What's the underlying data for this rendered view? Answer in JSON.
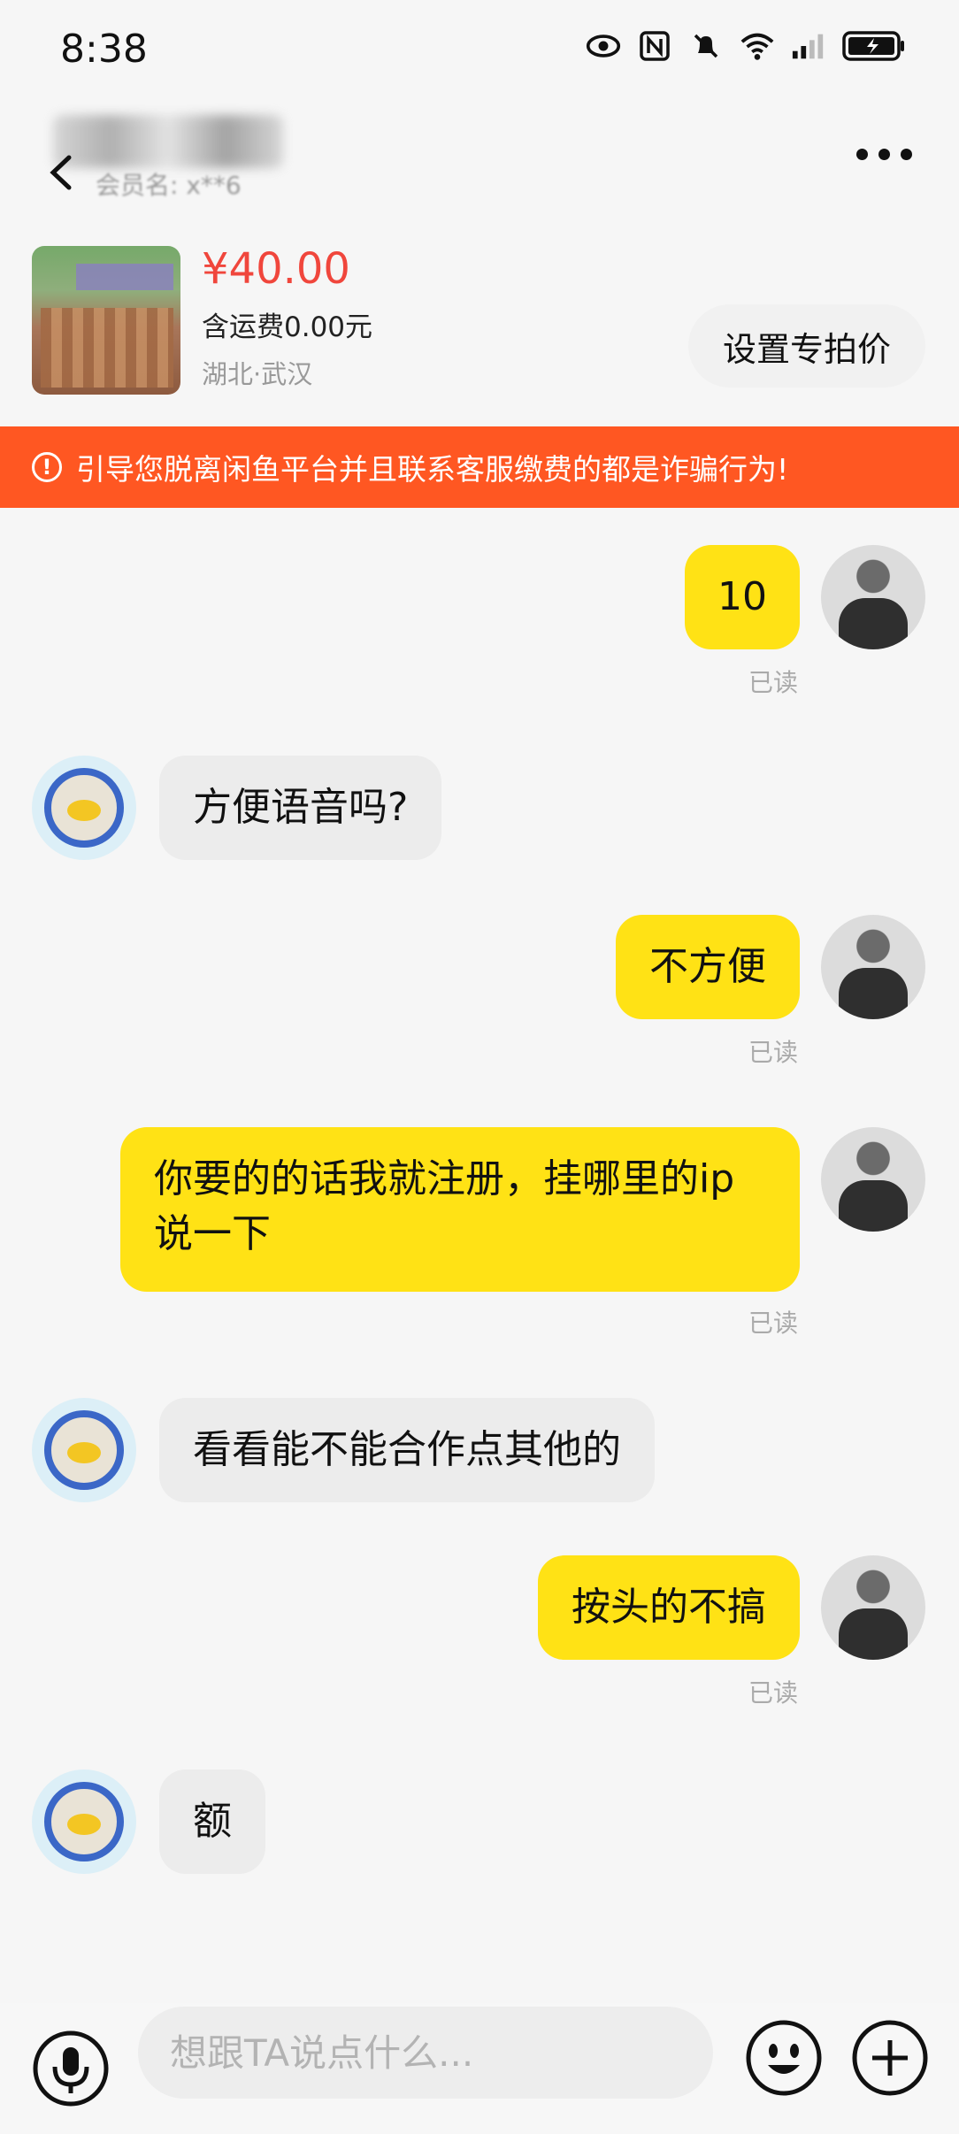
{
  "status": {
    "time": "8:38"
  },
  "header": {
    "seller_sub": "会员名: x**6"
  },
  "item": {
    "price": "¥40.00",
    "shipping": "含运费0.00元",
    "location": "湖北·武汉",
    "special_price_label": "设置专拍价"
  },
  "warning": {
    "text": "引导您脱离闲鱼平台并且联系客服缴费的都是诈骗行为!"
  },
  "messages": [
    {
      "from": "me",
      "text": "10",
      "status": "已读"
    },
    {
      "from": "them",
      "text": "方便语音吗?"
    },
    {
      "from": "me",
      "text": "不方便",
      "status": "已读"
    },
    {
      "from": "me",
      "text": "你要的的话我就注册，挂哪里的ip说一下",
      "status": "已读"
    },
    {
      "from": "them",
      "text": "看看能不能合作点其他的"
    },
    {
      "from": "me",
      "text": "按头的不搞",
      "status": "已读"
    },
    {
      "from": "them",
      "text": "额"
    }
  ],
  "input": {
    "placeholder": "想跟TA说点什么..."
  },
  "colors": {
    "accent_yellow": "#ffe215",
    "warning_orange": "#ff5722",
    "price_red": "#f0463c"
  }
}
